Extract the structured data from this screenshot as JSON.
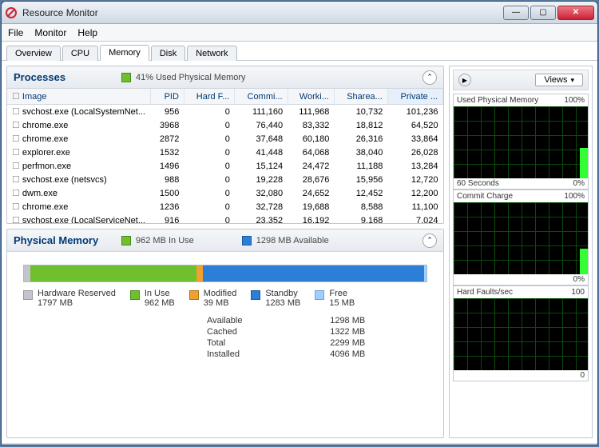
{
  "window": {
    "title": "Resource Monitor"
  },
  "menu": [
    "File",
    "Monitor",
    "Help"
  ],
  "tabs": [
    "Overview",
    "CPU",
    "Memory",
    "Disk",
    "Network"
  ],
  "activeTab": "Memory",
  "processesPanel": {
    "title": "Processes",
    "info": "41% Used Physical Memory"
  },
  "columns": [
    "Image",
    "PID",
    "Hard F...",
    "Commi...",
    "Worki...",
    "Sharea...",
    "Private ..."
  ],
  "rows": [
    {
      "image": "svchost.exe (LocalSystemNet...",
      "pid": "956",
      "hf": "0",
      "commit": "111,160",
      "work": "111,968",
      "share": "10,732",
      "priv": "101,236"
    },
    {
      "image": "chrome.exe",
      "pid": "3968",
      "hf": "0",
      "commit": "76,440",
      "work": "83,332",
      "share": "18,812",
      "priv": "64,520"
    },
    {
      "image": "chrome.exe",
      "pid": "2872",
      "hf": "0",
      "commit": "37,648",
      "work": "60,180",
      "share": "26,316",
      "priv": "33,864"
    },
    {
      "image": "explorer.exe",
      "pid": "1532",
      "hf": "0",
      "commit": "41,448",
      "work": "64,068",
      "share": "38,040",
      "priv": "26,028"
    },
    {
      "image": "perfmon.exe",
      "pid": "1496",
      "hf": "0",
      "commit": "15,124",
      "work": "24,472",
      "share": "11,188",
      "priv": "13,284"
    },
    {
      "image": "svchost.exe (netsvcs)",
      "pid": "988",
      "hf": "0",
      "commit": "19,228",
      "work": "28,676",
      "share": "15,956",
      "priv": "12,720"
    },
    {
      "image": "dwm.exe",
      "pid": "1500",
      "hf": "0",
      "commit": "32,080",
      "work": "24,652",
      "share": "12,452",
      "priv": "12,200"
    },
    {
      "image": "chrome.exe",
      "pid": "1236",
      "hf": "0",
      "commit": "32,728",
      "work": "19,688",
      "share": "8,588",
      "priv": "11,100"
    },
    {
      "image": "svchost.exe (LocalServiceNet...",
      "pid": "916",
      "hf": "0",
      "commit": "23,352",
      "work": "16,192",
      "share": "9,168",
      "priv": "7,024"
    }
  ],
  "physicalPanel": {
    "title": "Physical Memory",
    "inuse": "962 MB In Use",
    "available": "1298 MB Available"
  },
  "legend": {
    "hw": {
      "label": "Hardware Reserved",
      "val": "1797 MB",
      "color": "#c2c6cc"
    },
    "inuse": {
      "label": "In Use",
      "val": "962 MB",
      "color": "#6fbf2e"
    },
    "modified": {
      "label": "Modified",
      "val": "39 MB",
      "color": "#f0a030"
    },
    "standby": {
      "label": "Standby",
      "val": "1283 MB",
      "color": "#2d7ed6"
    },
    "free": {
      "label": "Free",
      "val": "15 MB",
      "color": "#9ed0ff"
    }
  },
  "stats": {
    "Available": "1298 MB",
    "Cached": "1322 MB",
    "Total": "2299 MB",
    "Installed": "4096 MB"
  },
  "rightPanel": {
    "viewsLabel": "Views",
    "charts": [
      {
        "title": "Used Physical Memory",
        "right": "100%",
        "foot_l": "60 Seconds",
        "foot_r": "0%",
        "peak": 42
      },
      {
        "title": "Commit Charge",
        "right": "100%",
        "foot_l": "",
        "foot_r": "0%",
        "peak": 36
      },
      {
        "title": "Hard Faults/sec",
        "right": "100",
        "foot_l": "",
        "foot_r": "0",
        "peak": 0
      }
    ]
  },
  "chart_data": {
    "type": "table",
    "title": "Process Memory (KB)",
    "columns": [
      "Image",
      "PID",
      "HardFaults",
      "Commit",
      "Working",
      "Shareable",
      "Private"
    ],
    "rows": [
      [
        "svchost.exe (LocalSystemNet...)",
        956,
        0,
        111160,
        111968,
        10732,
        101236
      ],
      [
        "chrome.exe",
        3968,
        0,
        76440,
        83332,
        18812,
        64520
      ],
      [
        "chrome.exe",
        2872,
        0,
        37648,
        60180,
        26316,
        33864
      ],
      [
        "explorer.exe",
        1532,
        0,
        41448,
        64068,
        38040,
        26028
      ],
      [
        "perfmon.exe",
        1496,
        0,
        15124,
        24472,
        11188,
        13284
      ],
      [
        "svchost.exe (netsvcs)",
        988,
        0,
        19228,
        28676,
        15956,
        12720
      ],
      [
        "dwm.exe",
        1500,
        0,
        32080,
        24652,
        12452,
        12200
      ],
      [
        "chrome.exe",
        1236,
        0,
        32728,
        19688,
        8588,
        11100
      ],
      [
        "svchost.exe (LocalServiceNet...)",
        916,
        0,
        23352,
        16192,
        9168,
        7024
      ]
    ],
    "memory_summary_mb": {
      "hardware_reserved": 1797,
      "in_use": 962,
      "modified": 39,
      "standby": 1283,
      "free": 15,
      "available": 1298,
      "cached": 1322,
      "total": 2299,
      "installed": 4096,
      "used_pct": 41
    }
  }
}
